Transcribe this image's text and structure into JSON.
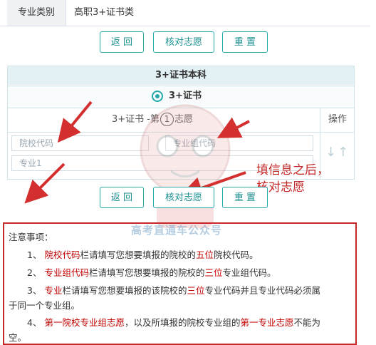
{
  "category": {
    "label": "专业类别",
    "value": "高职3+证书类"
  },
  "buttons_top": {
    "back": "返 回",
    "check": "核对志愿",
    "reset": "重 置"
  },
  "form": {
    "title": "3+证书本科",
    "radio_label": "3+证书",
    "choice_prefix": "3+证书 -第",
    "choice_number": "1",
    "choice_suffix": "志愿",
    "operation_header": "操作",
    "placeholders": {
      "school_code": "院校代码",
      "group_code": "专业组代码",
      "major1": "专业1"
    }
  },
  "annotation": {
    "line1": "填信息之后，",
    "line2": "核对志愿"
  },
  "buttons_bottom": {
    "back": "返 回",
    "check": "核对志愿",
    "reset": "重 置"
  },
  "watermark": "高考直通车公众号",
  "notes": {
    "title": "注意事项：",
    "items": [
      {
        "num": "1、",
        "hl1": "院校代码",
        "t1": "栏请填写您想要填报的院校的",
        "hl2": "五位",
        "t2": "院校代码。"
      },
      {
        "num": "2、",
        "hl1": "专业组代码",
        "t1": "栏请填写您想要填报的院校的",
        "hl2": "三位",
        "t2": "专业组代码。"
      },
      {
        "num": "3、",
        "hl1": "专业",
        "t1": "栏请填写您想要填报的该院校的",
        "hl2": "三位",
        "t2": "专业代码并且专业代码必须属",
        "cont": "于同一个专业组。"
      },
      {
        "num": "4、",
        "hl1": "第一院校专业组志愿",
        "t1": "，以及所填报的院校专业组的",
        "hl2": "第一专业志愿",
        "t2": "不能为",
        "cont": "空。"
      }
    ]
  },
  "colors": {
    "accent": "#27a9a9",
    "highlight": "#c00000",
    "annotation": "#c62828"
  }
}
